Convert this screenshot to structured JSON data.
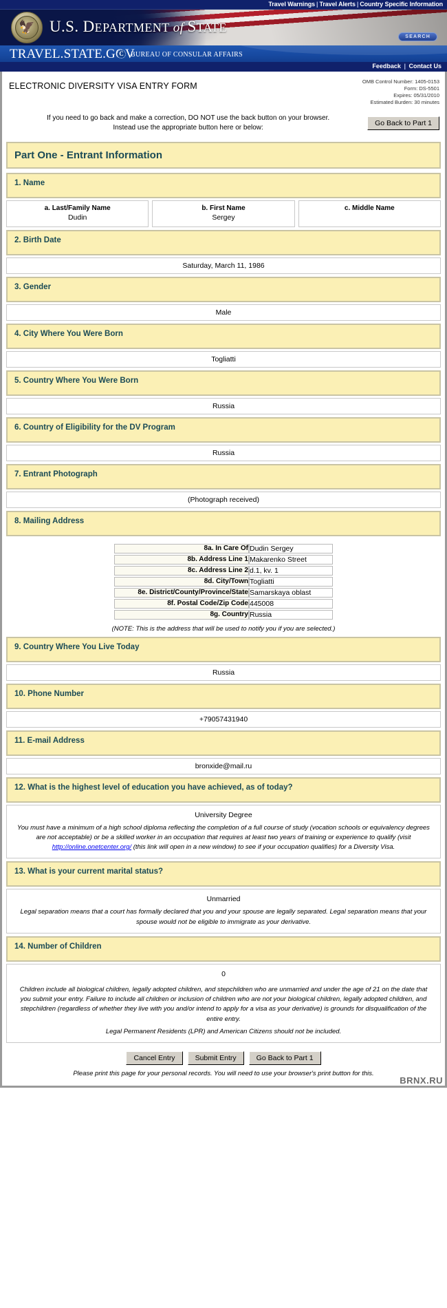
{
  "utility_nav": {
    "items": [
      "Travel Warnings",
      "Travel Alerts",
      "Country Specific Information"
    ],
    "separator": "|"
  },
  "banner": {
    "department_title_part1": "U.S. D",
    "department_title_small1": "EPARTMENT",
    "department_title_italic": " of ",
    "department_title_part2": "S",
    "department_title_small2": "TATE",
    "seal_icon": "eagle-seal-icon",
    "search_label": "SEARCH"
  },
  "tsg_bar": {
    "site_title": "TRAVEL.STATE.GOV",
    "ca_mark": "C",
    "bureau": "BUREAU OF CONSULAR AFFAIRS"
  },
  "feedback_bar": {
    "items": [
      "Feedback",
      "Contact Us"
    ],
    "separator": "|"
  },
  "form": {
    "title": "ELECTRONIC DIVERSITY VISA ENTRY FORM",
    "omb": {
      "control_number": "OMB Control Number: 1405-0153",
      "form_number": "Form: DS-5501",
      "expires": "Expires: 05/31/2010",
      "burden": "Estimated Burden: 30 minutes"
    },
    "notice_line1": "If you need to go back and make a correction, DO NOT use the back button on your browser.",
    "notice_line2": "Instead use the appropriate button here or below:",
    "go_back_top_label": "Go Back to Part 1",
    "part_header": "Part One - Entrant Information"
  },
  "questions": {
    "q1": {
      "header": "1. Name",
      "fields": [
        {
          "label": "a. Last/Family Name",
          "value": "Dudin"
        },
        {
          "label": "b. First Name",
          "value": "Sergey"
        },
        {
          "label": "c. Middle Name",
          "value": ""
        }
      ]
    },
    "q2": {
      "header": "2. Birth Date",
      "value": "Saturday, March 11, 1986"
    },
    "q3": {
      "header": "3. Gender",
      "value": "Male"
    },
    "q4": {
      "header": "4. City Where You Were Born",
      "value": "Togliatti"
    },
    "q5": {
      "header": "5. Country Where You Were Born",
      "value": "Russia"
    },
    "q6": {
      "header": "6. Country of Eligibility for the DV Program",
      "value": "Russia"
    },
    "q7": {
      "header": "7. Entrant Photograph",
      "value": "(Photograph received)"
    },
    "q8": {
      "header": "8. Mailing Address",
      "rows": [
        {
          "label": "8a. In Care Of",
          "value": "Dudin Sergey"
        },
        {
          "label": "8b. Address Line 1",
          "value": "Makarenko Street"
        },
        {
          "label": "8c. Address Line 2",
          "value": "d.1, kv. 1"
        },
        {
          "label": "8d. City/Town",
          "value": "Togliatti"
        },
        {
          "label": "8e. District/County/Province/State",
          "value": "Samarskaya oblast"
        },
        {
          "label": "8f. Postal Code/Zip Code",
          "value": "445008"
        },
        {
          "label": "8g. Country",
          "value": "Russia"
        }
      ],
      "note": "(NOTE: This is the address that will be used to notify you if you are selected.)"
    },
    "q9": {
      "header": "9. Country Where You Live Today",
      "value": "Russia"
    },
    "q10": {
      "header": "10. Phone Number",
      "value": "+79057431940"
    },
    "q11": {
      "header": "11. E-mail Address",
      "value": "bronxide@mail.ru"
    },
    "q12": {
      "header": "12. What is the highest level of education you have achieved, as of today?",
      "value": "University Degree",
      "note_part1": "You must have a minimum of a high school diploma reflecting the completion of a full course of study (vocation schools or equivalency degrees are not acceptable) or be a skilled worker in an occupation that requires at least two years of training or experience to qualify (visit ",
      "note_link": "http://online.onetcenter.org/",
      "note_link_hint": "(this link will open in a new window)",
      "note_part2": " to see if your occupation qualifies) for a Diversity Visa."
    },
    "q13": {
      "header": "13. What is your current marital status?",
      "value": "Unmarried",
      "note": "Legal separation means that a court has formally declared that you and your spouse are legally separated. Legal separation means that your spouse would not be eligible to immigrate as your derivative."
    },
    "q14": {
      "header": "14. Number of Children",
      "value": "0",
      "note1": "Children include all biological children, legally adopted children, and stepchildren who are unmarried and under the age of 21 on the date that you submit your entry. Failure to include all children or inclusion of children who are not your biological children, legally adopted children, and stepchildren (regardless of whether they live with you and/or intend to apply for a visa as your derivative) is grounds for disqualification of the entire entry.",
      "note2": "Legal Permanent Residents (LPR) and American Citizens should not be included."
    }
  },
  "footer": {
    "cancel_label": "Cancel Entry",
    "submit_label": "Submit Entry",
    "go_back_label": "Go Back to Part 1",
    "print_note": "Please print this page for your personal records. You will need to use your browser's print button for this."
  },
  "watermark": "BRNX.RU",
  "colors": {
    "navy": "#10216b",
    "blue": "#1749a0",
    "header_yellow": "#fbf0b5",
    "header_text": "#1b4b56"
  }
}
